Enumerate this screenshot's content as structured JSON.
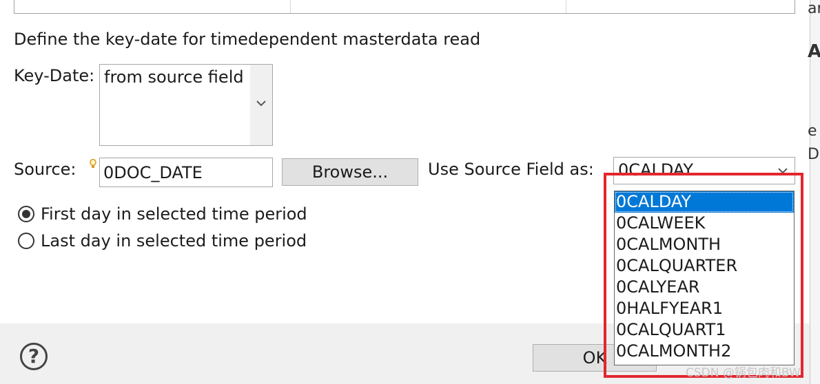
{
  "dialog": {
    "description": "Define the key-date for timedependent masterdata read",
    "key_date_label": "Key-Date:",
    "key_date_value": "from source field",
    "source_label": "Source:",
    "source_value": "0DOC_DATE",
    "browse_label": "Browse...",
    "use_source_label": "Use Source Field as:",
    "use_source_value": "0CALDAY",
    "radio_first": "First day in selected time period",
    "radio_last": "Last day in selected time period",
    "radio_selected": "first",
    "ok_label": "OK",
    "help_glyph": "?"
  },
  "dropdown": {
    "items": [
      "0CALDAY",
      "0CALWEEK",
      "0CALMONTH",
      "0CALQUARTER",
      "0CALYEAR",
      "0HALFYEAR1",
      "0CALQUART1",
      "0CALMONTH2"
    ],
    "selected": "0CALDAY"
  },
  "right_pane": {
    "fragments": [
      "ar",
      "A",
      "e",
      "DI"
    ]
  },
  "watermark": "CSDN @锅包肉和BW",
  "colors": {
    "selection": "#0078d7",
    "highlight_box": "#e3262e",
    "footer": "#f0f0f0"
  },
  "icons": {
    "dropdown_arrow": "chevron-down-icon",
    "warning": "lightbulb-warning-icon",
    "help": "help-icon"
  }
}
